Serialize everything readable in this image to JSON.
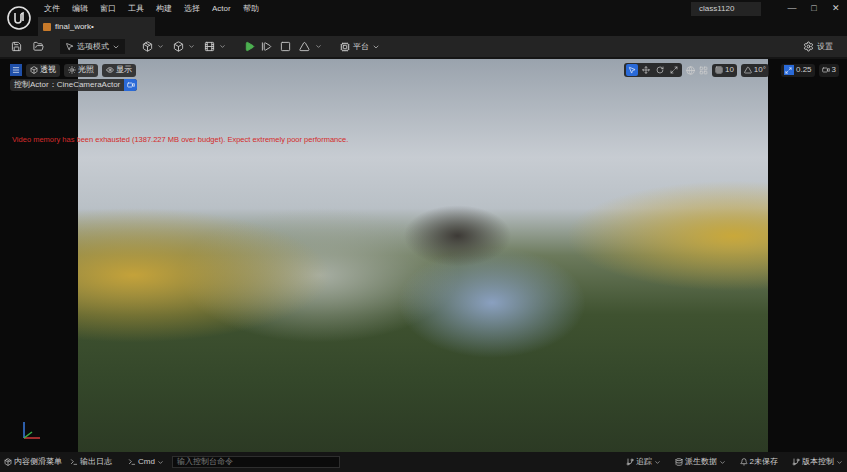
{
  "window": {
    "project": "class1120",
    "controls": [
      "—",
      "□",
      "✕"
    ]
  },
  "menu": [
    "文件",
    "编辑",
    "窗口",
    "工具",
    "构建",
    "选择",
    "Actor",
    "帮助"
  ],
  "tabs": [
    {
      "label": "final_work•",
      "selected": true
    }
  ],
  "toolbar": {
    "mode": "选项模式",
    "platform": "平台",
    "settings": "设置"
  },
  "viewport": {
    "view_buttons": [
      "透视",
      "光照",
      "显示"
    ],
    "pilot": "控制Actor：CineCameraActor",
    "warning": "Video memory has been exhausted (1387.227 MB over budget). Expect extremely poor performance.",
    "transform_tools": [
      {
        "tool": "select",
        "selected": true
      },
      {
        "tool": "move",
        "selected": false
      },
      {
        "tool": "rotate",
        "selected": false
      },
      {
        "tool": "scale",
        "selected": false
      }
    ],
    "grid_snap": "10",
    "rotate_snap": "10°",
    "scale_snap": "0.25",
    "camera_speed": "3"
  },
  "status_bar": {
    "left": [
      "内容侧滑菜单",
      "输出日志"
    ],
    "cmd": "Cmd",
    "console_placeholder": "输入控制台命令",
    "right": [
      "追踪",
      "派生数据",
      "2未保存",
      "版本控制"
    ]
  }
}
